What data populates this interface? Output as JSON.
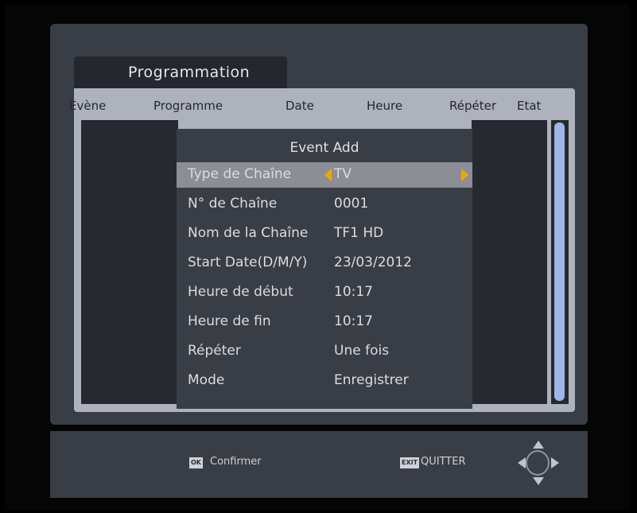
{
  "header": {
    "title": "Programmation"
  },
  "list": {
    "columns": [
      "Evène",
      "Programme",
      "Date",
      "Heure",
      "Répéter",
      "Etat"
    ]
  },
  "dialog": {
    "title": "Event Add",
    "rows": [
      {
        "label": "Type de Chaîne",
        "value": "TV"
      },
      {
        "label": "N° de Chaîne",
        "value": "0001"
      },
      {
        "label": "Nom de la Chaîne",
        "value": "TF1 HD"
      },
      {
        "label": "Start Date(D/M/Y)",
        "value": "23/03/2012"
      },
      {
        "label": "Heure de début",
        "value": "10:17"
      },
      {
        "label": "Heure de fin",
        "value": "10:17"
      },
      {
        "label": "Répéter",
        "value": "Une fois"
      },
      {
        "label": "Mode",
        "value": "Enregistrer"
      }
    ]
  },
  "footer": {
    "ok_key": "OK",
    "confirm_label": "Confirmer",
    "exit_key": "EXIT",
    "exit_label": "QUITTER"
  },
  "colors": {
    "highlight_arrow": "#f0a800",
    "scrollbar": "#9fb6e6"
  }
}
